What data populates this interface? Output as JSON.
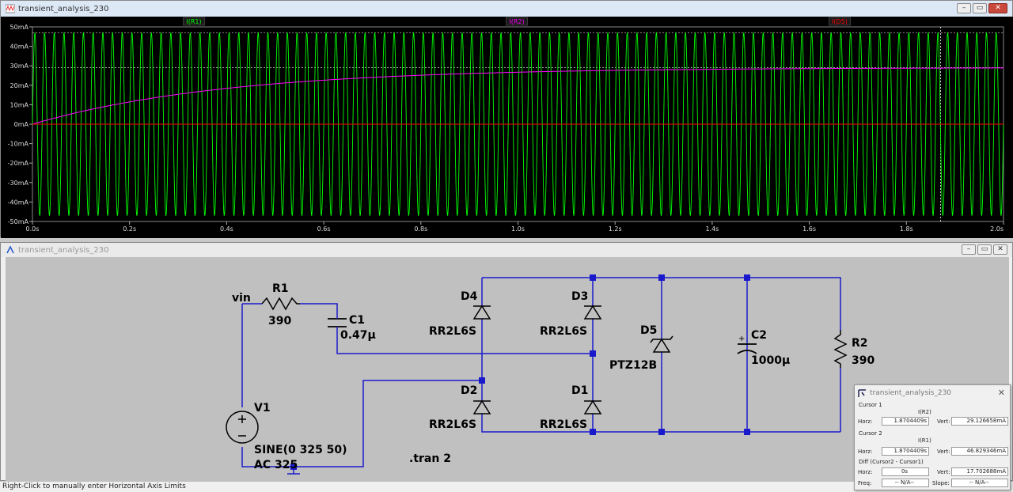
{
  "waveform_window": {
    "title": "transient_analysis_230",
    "buttons": {
      "minimize": "–",
      "restore": "▭",
      "close": "✕"
    },
    "trace_labels": [
      {
        "text": "I(R1)",
        "color": "#00ff00"
      },
      {
        "text": "I(R2)",
        "color": "#ff00ff"
      },
      {
        "text": "I(D5)",
        "color": "#ff0000"
      }
    ]
  },
  "chart_data": {
    "type": "line",
    "title": "",
    "xlabel": "",
    "ylabel": "",
    "xlim": [
      0,
      2.0
    ],
    "ylim": [
      -50,
      50
    ],
    "x_ticks": [
      "0.0s",
      "0.2s",
      "0.4s",
      "0.6s",
      "0.8s",
      "1.0s",
      "1.2s",
      "1.4s",
      "1.6s",
      "1.8s",
      "2.0s"
    ],
    "y_ticks": [
      "50mA",
      "40mA",
      "30mA",
      "20mA",
      "10mA",
      "0mA",
      "-10mA",
      "-20mA",
      "-30mA",
      "-40mA",
      "-50mA"
    ],
    "series": [
      {
        "name": "I(R1)",
        "color": "#00ff00",
        "kind": "sine",
        "amplitude_mA": 47,
        "frequency_hz": 50
      },
      {
        "name": "I(R2)",
        "color": "#ff00ff",
        "kind": "charging",
        "final_mA": 29.1,
        "tau_s": 0.4
      },
      {
        "name": "I(D5)",
        "color": "#ff0000",
        "kind": "constant",
        "value_mA": 0
      }
    ],
    "cursor_x": 1.8704409
  },
  "schematic_window": {
    "title": "transient_analysis_230",
    "buttons": {
      "minimize": "–",
      "restore": "▭",
      "close": "✕"
    },
    "labels": {
      "vin": "vin",
      "r1_name": "R1",
      "r1_value": "390",
      "c1_name": "C1",
      "c1_value": "0.47µ",
      "d4_name": "D4",
      "d4_model": "RR2L6S",
      "d3_name": "D3",
      "d3_model": "RR2L6S",
      "d2_name": "D2",
      "d2_model": "RR2L6S",
      "d1_name": "D1",
      "d1_model": "RR2L6S",
      "d5_name": "D5",
      "d5_model": "PTZ12B",
      "c2_name": "C2",
      "c2_value": "1000µ",
      "r2_name": "R2",
      "r2_value": "390",
      "v1_name": "V1",
      "v1_value": "SINE(0 325 50)",
      "v1_ac": "AC 325",
      "tran": ".tran 2"
    }
  },
  "cursor_window": {
    "title": "transient_analysis_230",
    "close": "✕",
    "cursor1_label": "Cursor 1",
    "cursor1_trace": "I(R2)",
    "cursor1_horz": "1.8704409s",
    "cursor1_vert": "29.126658mA",
    "cursor2_label": "Cursor 2",
    "cursor2_trace": "I(R1)",
    "cursor2_horz": "1.8704409s",
    "cursor2_vert": "46.829346mA",
    "diff_label": "Diff (Cursor2 - Cursor1)",
    "diff_horz": "0s",
    "diff_vert": "17.702688mA",
    "freq_value": "-- N/A--",
    "slope_value": "-- N/A--",
    "horz_label": "Horz:",
    "vert_label": "Vert:",
    "freq_label": "Freq:",
    "slope_label": "Slope:"
  },
  "status_bar": {
    "text": "Right-Click to manually enter Horizontal Axis Limits"
  }
}
